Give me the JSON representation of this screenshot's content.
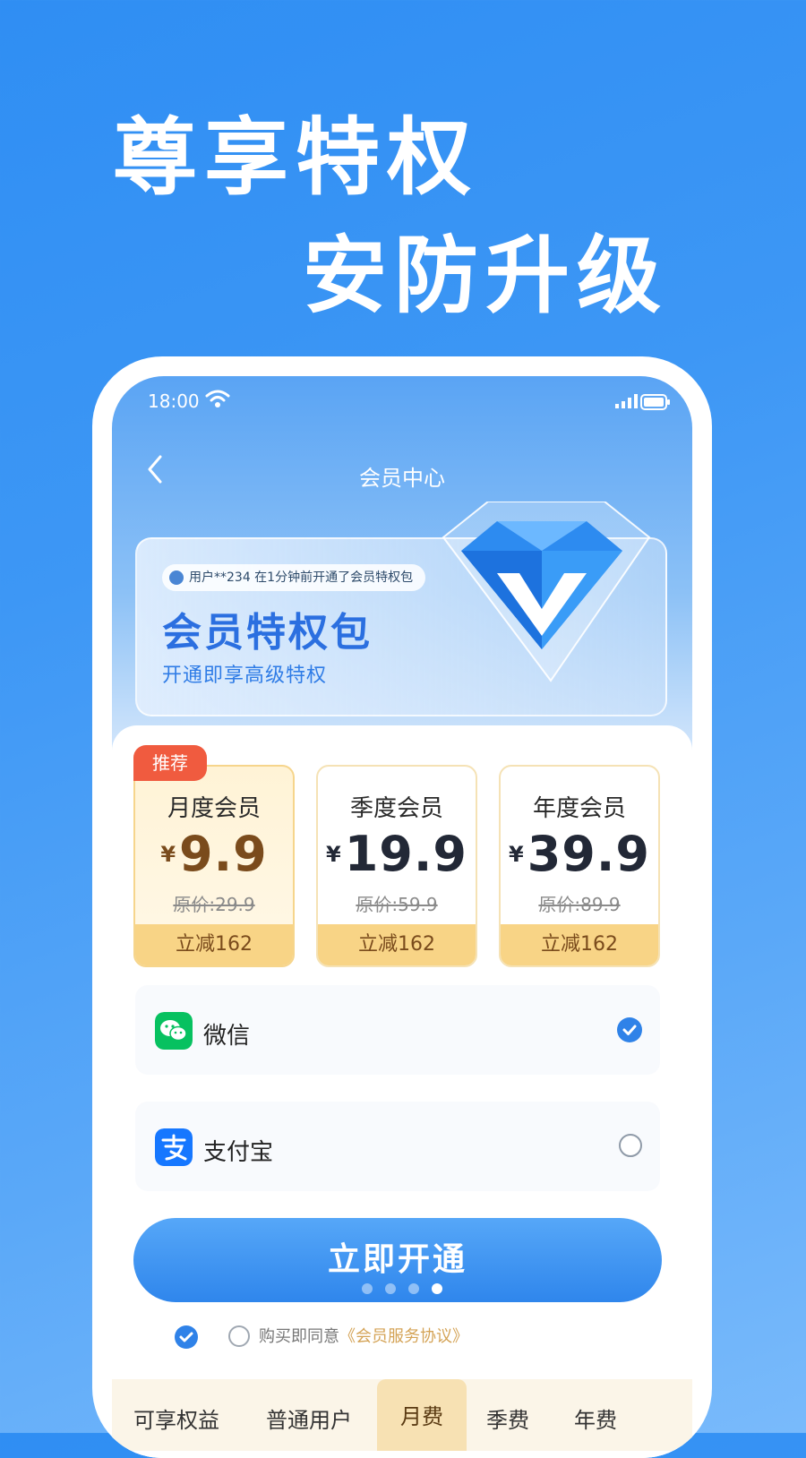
{
  "hero": {
    "line1": "尊享特权",
    "line2": "安防升级"
  },
  "status_bar": {
    "time": "18:00"
  },
  "nav": {
    "title": "会员中心"
  },
  "banner": {
    "ticker": "用户**234 在1分钟前开通了会员特权包",
    "title": "会员特权包",
    "subtitle": "开通即享高级特权"
  },
  "plans": [
    {
      "name": "月度会员",
      "currency": "¥",
      "price": "9.9",
      "original": "原价:29.9",
      "discount": "立减162",
      "tag": "推荐"
    },
    {
      "name": "季度会员",
      "currency": "¥",
      "price": "19.9",
      "original": "原价:59.9",
      "discount": "立减162"
    },
    {
      "name": "年度会员",
      "currency": "¥",
      "price": "39.9",
      "original": "原价:89.9",
      "discount": "立减162"
    }
  ],
  "payment": [
    {
      "label": "微信",
      "icon": "wechat-icon",
      "selected": true
    },
    {
      "label": "支付宝",
      "icon": "alipay-icon",
      "selected": false
    }
  ],
  "cta": {
    "label": "立即开通"
  },
  "agreement": {
    "text": "购买即同意",
    "link": "《会员服务协议》"
  },
  "comparison_header": [
    "可享权益",
    "普通用户",
    "月费",
    "季费",
    "年费"
  ],
  "colors": {
    "brand_blue": "#2f86ec",
    "gold": "#f8d486",
    "tag_red": "#f05b3f",
    "wechat_green": "#07c160",
    "alipay_blue": "#1677ff"
  }
}
